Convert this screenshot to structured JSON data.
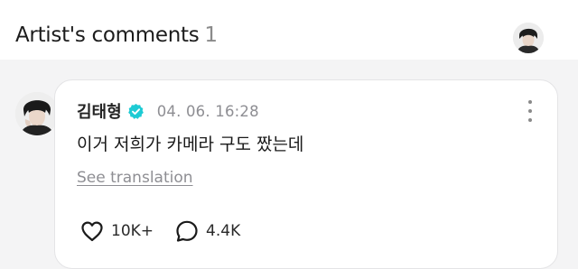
{
  "header": {
    "title": "Artist's comments",
    "count": "1",
    "avatar_icon": "artist-avatar"
  },
  "comment": {
    "author": "김태형",
    "verified_icon": "verified-check-icon",
    "verified_color": "#1ecbd4",
    "timestamp": "04. 06. 16:28",
    "text": "이거 저희가 카메라 구도 짰는데",
    "translate_label": "See translation",
    "more_icon": "more-vertical-icon",
    "likes": "10K+",
    "replies": "4.4K"
  }
}
